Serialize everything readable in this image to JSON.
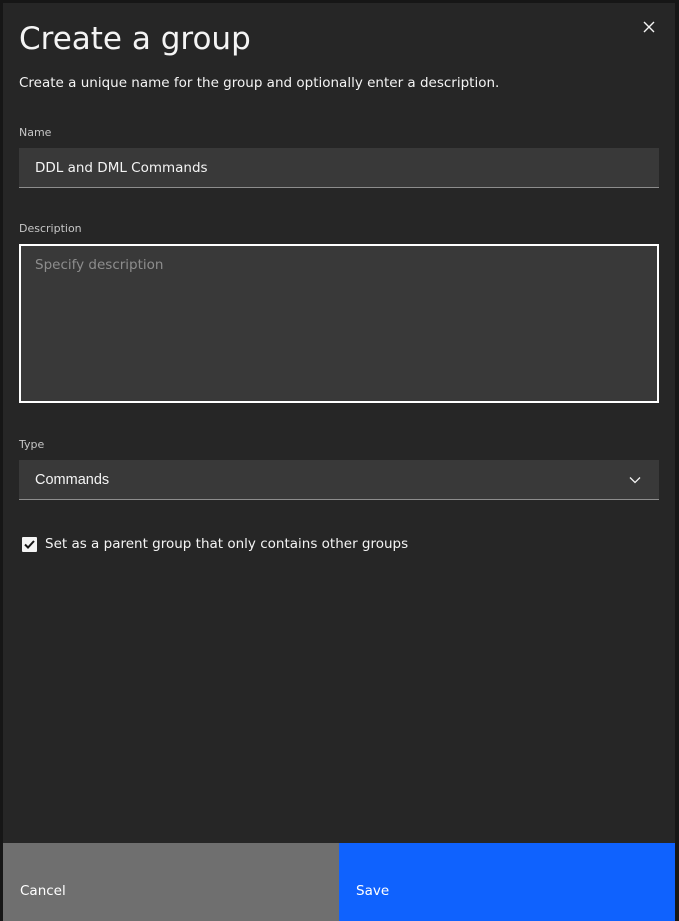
{
  "modal": {
    "title": "Create a group",
    "subtitle": "Create a unique name for the group and optionally enter a description.",
    "close_icon": "close-icon"
  },
  "form": {
    "name": {
      "label": "Name",
      "value": "DDL and DML Commands"
    },
    "description": {
      "label": "Description",
      "placeholder": "Specify description",
      "value": ""
    },
    "type": {
      "label": "Type",
      "selected": "Commands",
      "icon": "chevron-down-icon"
    },
    "parent_group": {
      "label": "Set as a parent group that only contains other groups",
      "checked": true,
      "icon": "checkmark-icon"
    }
  },
  "footer": {
    "cancel_label": "Cancel",
    "save_label": "Save"
  },
  "colors": {
    "background": "#262626",
    "field": "#393939",
    "primary": "#0f62fe",
    "secondary": "#6f6f6f",
    "text": "#f4f4f4"
  }
}
